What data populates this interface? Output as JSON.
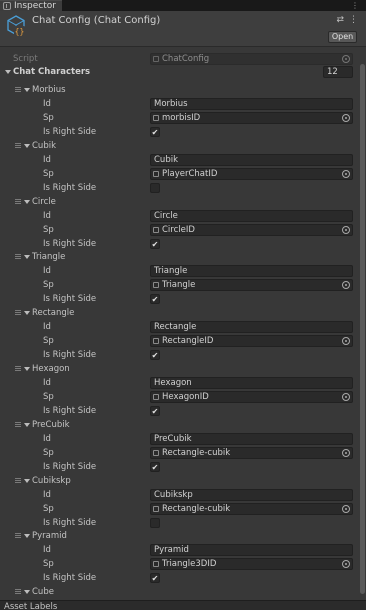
{
  "window": {
    "tab_label": "Inspector",
    "menu_glyph": "⋮"
  },
  "component": {
    "title": "Chat Config (Chat Config)",
    "open_label": "Open",
    "script_label": "Script",
    "script_value": "ChatConfig",
    "icon_name": "scriptable-object-icon"
  },
  "list": {
    "label": "Chat Characters",
    "count": "12",
    "field_labels": {
      "id": "Id",
      "sp": "Sp",
      "right": "Is Right Side"
    },
    "items": [
      {
        "name": "Morbius",
        "id": "Morbius",
        "sp": "morbisID",
        "right": true
      },
      {
        "name": "Cubik",
        "id": "Cubik",
        "sp": "PlayerChatID",
        "right": false
      },
      {
        "name": "Circle",
        "id": "Circle",
        "sp": "CircleID",
        "right": true
      },
      {
        "name": "Triangle",
        "id": "Triangle",
        "sp": "Triangle",
        "right": true
      },
      {
        "name": "Rectangle",
        "id": "Rectangle",
        "sp": "RectangleID",
        "right": true
      },
      {
        "name": "Hexagon",
        "id": "Hexagon",
        "sp": "HexagonID",
        "right": true
      },
      {
        "name": "PreCubik",
        "id": "PreCubik",
        "sp": "Rectangle-cubik",
        "right": true
      },
      {
        "name": "Cubikskp",
        "id": "Cubikskp",
        "sp": "Rectangle-cubik",
        "right": false
      },
      {
        "name": "Pyramid",
        "id": "Pyramid",
        "sp": "Triangle3DID",
        "right": true
      },
      {
        "name": "Cube"
      }
    ]
  },
  "footer": {
    "label": "Asset Labels"
  },
  "colors": {
    "panel": "#383838",
    "field": "#2a2a2a",
    "header": "#3e3e3e",
    "accent_icon": "#4a9fd8"
  }
}
